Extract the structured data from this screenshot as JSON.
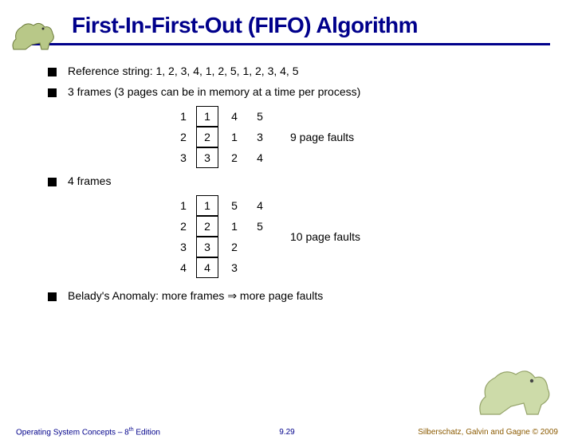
{
  "title": "First-In-First-Out (FIFO) Algorithm",
  "bullets": {
    "b0": "Reference string: 1, 2, 3, 4, 1, 2, 5, 1, 2, 3, 4, 5",
    "b1": "3 frames (3 pages can be in memory at a time per process)",
    "b2": "4 frames",
    "b3_pre": "Belady's Anomaly: more frames ",
    "b3_arrow": "⇒",
    "b3_post": " more page faults"
  },
  "table3": {
    "frame_labels": [
      "1",
      "2",
      "3"
    ],
    "cols": [
      [
        "1",
        "2",
        "3"
      ],
      [
        "4",
        "1",
        "2"
      ],
      [
        "5",
        "3",
        "4"
      ]
    ],
    "faults": "9 page faults"
  },
  "table4": {
    "frame_labels": [
      "1",
      "2",
      "3",
      "4"
    ],
    "cols": [
      [
        "1",
        "2",
        "3",
        "4"
      ],
      [
        "5",
        "1",
        "2",
        "3"
      ],
      [
        "4",
        "5",
        "",
        ""
      ]
    ],
    "faults": "10 page faults"
  },
  "footer": {
    "left_pre": "Operating System Concepts – 8",
    "left_sup": "th",
    "left_post": " Edition",
    "mid": "9.29",
    "right": "Silberschatz, Galvin and Gagne © 2009"
  }
}
